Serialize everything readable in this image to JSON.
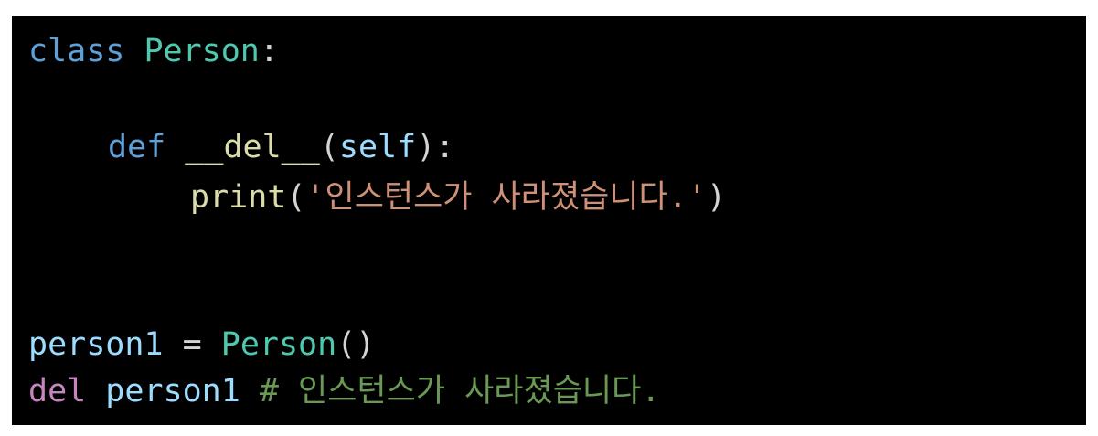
{
  "code": {
    "line1": {
      "keyword": "class",
      "class_name": "Person",
      "colon": ":"
    },
    "line2": {
      "keyword": "def",
      "func_name": "__del__",
      "open_paren": "(",
      "param": "self",
      "close_paren_colon": "):"
    },
    "line3": {
      "func_name": "print",
      "open_paren": "(",
      "string": "'인스턴스가 사라졌습니다.'",
      "close_paren": ")"
    },
    "line4": {
      "variable": "person1",
      "operator": "=",
      "class_call": "Person",
      "parens": "()"
    },
    "line5": {
      "keyword": "del",
      "variable": "person1",
      "comment": "# 인스턴스가 사라졌습니다."
    }
  },
  "colors": {
    "background": "#000000",
    "keyword": "#5fa0d6",
    "class_name": "#4ec9b0",
    "function": "#dcdcaa",
    "variable": "#9cdcfe",
    "string": "#ce9178",
    "del_keyword": "#c586c0",
    "comment": "#6a9955"
  }
}
